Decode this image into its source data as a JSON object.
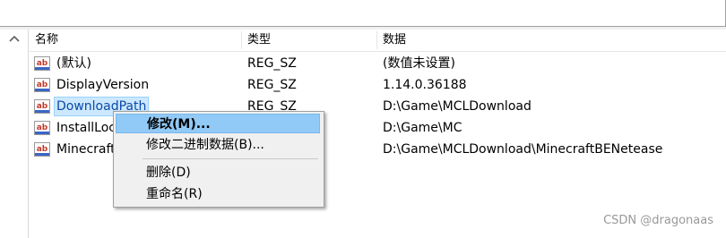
{
  "columns": {
    "name": "名称",
    "type": "类型",
    "data": "数据"
  },
  "rows": [
    {
      "name": "(默认)",
      "type": "REG_SZ",
      "data": "(数值未设置)"
    },
    {
      "name": "DisplayVersion",
      "type": "REG_SZ",
      "data": "1.14.0.36188"
    },
    {
      "name": "DownloadPath",
      "type": "REG_SZ",
      "data": "D:\\Game\\MCLDownload"
    },
    {
      "name": "InstallLoc",
      "type": "",
      "data": "D:\\Game\\MC"
    },
    {
      "name": "Minecraft",
      "type": "",
      "data": "D:\\Game\\MCLDownload\\MinecraftBENetease"
    }
  ],
  "row_icon_text": "ab",
  "context_menu": {
    "modify": "修改(M)...",
    "modify_binary": "修改二进制数据(B)...",
    "delete": "删除(D)",
    "rename": "重命名(R)"
  },
  "watermark": "CSDN @dragonaas",
  "icons": [
    "scroll-up-chevron-icon",
    "string-value-icon"
  ],
  "colors": {
    "selection": "#cce8ff",
    "menu_highlight": "#91c9f7",
    "menu_background": "#f0f0f0"
  }
}
